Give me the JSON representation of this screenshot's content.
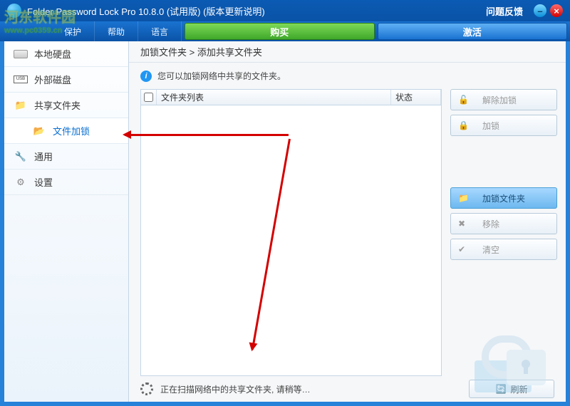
{
  "titlebar": {
    "app_title": "Folder Password Lock Pro 10.8.0 (试用版) (版本更新说明)",
    "feedback": "问题反馈"
  },
  "menubar": {
    "items": [
      "保护",
      "帮助",
      "语言"
    ],
    "buy": "购买",
    "activate": "激活"
  },
  "sidebar": {
    "items": [
      {
        "label": "本地硬盘"
      },
      {
        "label": "外部磁盘",
        "badge": "USB"
      },
      {
        "label": "共享文件夹"
      },
      {
        "label": "文件加锁"
      },
      {
        "label": "通用"
      },
      {
        "label": "设置"
      }
    ]
  },
  "breadcrumb": "加锁文件夹 > 添加共享文件夹",
  "info_text": "您可以加锁网络中共享的文件夹。",
  "table": {
    "columns": {
      "name": "文件夹列表",
      "status": "状态"
    }
  },
  "rpanel": {
    "unlock": "解除加锁",
    "lock": "加锁",
    "lock_folder": "加锁文件夹",
    "remove": "移除",
    "clear": "清空"
  },
  "status": {
    "text": "正在扫描网络中的共享文件夹, 请稍等…",
    "refresh": "刷新"
  },
  "watermark": {
    "line1": "河东软件园",
    "line2": "www.pc0359.cn"
  }
}
